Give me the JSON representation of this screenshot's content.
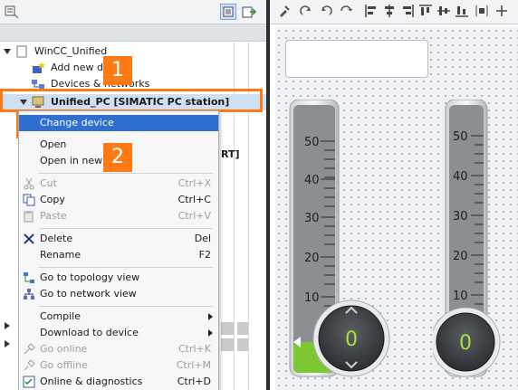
{
  "tree": {
    "root_label": "WinCC_Unified",
    "items": [
      {
        "label": "Add new d"
      },
      {
        "label": "Devices & networks"
      },
      {
        "label": "Unified_PC [SIMATIC PC station]"
      }
    ],
    "partial_column_text": "RT]"
  },
  "callouts": [
    "1",
    "2"
  ],
  "context_menu": {
    "items": [
      {
        "label": "Change device",
        "shortcut": "",
        "state": "highlighted"
      },
      {
        "label": "Open",
        "shortcut": "",
        "state": "enabled"
      },
      {
        "label": "Open in new",
        "shortcut": "",
        "state": "enabled"
      },
      {
        "label": "Cut",
        "shortcut": "Ctrl+X",
        "state": "disabled",
        "icon": "scissors-icon"
      },
      {
        "label": "Copy",
        "shortcut": "Ctrl+C",
        "state": "enabled",
        "icon": "copy-icon"
      },
      {
        "label": "Paste",
        "shortcut": "Ctrl+V",
        "state": "disabled",
        "icon": "paste-icon"
      },
      {
        "label": "Delete",
        "shortcut": "Del",
        "state": "enabled",
        "icon": "delete-x-icon"
      },
      {
        "label": "Rename",
        "shortcut": "F2",
        "state": "enabled"
      },
      {
        "label": "Go to topology view",
        "shortcut": "",
        "state": "enabled",
        "icon": "topology-icon"
      },
      {
        "label": "Go to network view",
        "shortcut": "",
        "state": "enabled",
        "icon": "network-icon"
      },
      {
        "label": "Compile",
        "shortcut": "",
        "state": "enabled",
        "submenu": true
      },
      {
        "label": "Download to device",
        "shortcut": "",
        "state": "enabled",
        "submenu": true
      },
      {
        "label": "Go online",
        "shortcut": "Ctrl+K",
        "state": "disabled",
        "icon": "go-online-icon"
      },
      {
        "label": "Go offline",
        "shortcut": "Ctrl+M",
        "state": "disabled",
        "icon": "go-offline-icon"
      },
      {
        "label": "Online & diagnostics",
        "shortcut": "Ctrl+D",
        "state": "enabled",
        "icon": "diagnostics-icon"
      }
    ]
  },
  "gauges": [
    {
      "scale_labels": [
        "50",
        "40",
        "30",
        "20",
        "10"
      ],
      "value": "0",
      "level": 0.1
    },
    {
      "scale_labels": [
        "50",
        "40",
        "30",
        "20",
        "10"
      ],
      "value": "0",
      "level": 0.05
    }
  ],
  "colors": {
    "accent_orange": "#ff7a14",
    "menu_highlight": "#2f6fd1",
    "gauge_green": "#7dc832",
    "gauge_value_green": "#a6e040"
  }
}
